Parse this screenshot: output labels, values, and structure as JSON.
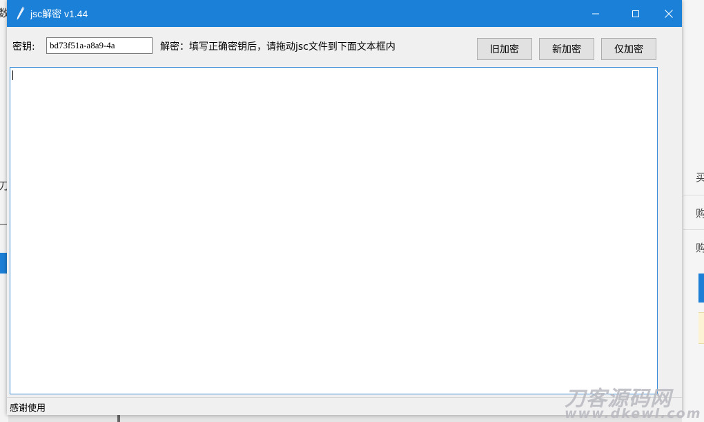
{
  "window": {
    "title": "jsc解密 v1.44"
  },
  "form": {
    "key_label": "密钥:",
    "key_value": "bd73f51a-a8a9-4a",
    "hint": "解密：填写正确密钥后，请拖动jsc文件到下面文本框内"
  },
  "buttons": {
    "old_encrypt": "旧加密",
    "new_encrypt": "新加密",
    "only_encrypt": "仅加密"
  },
  "status": {
    "text": "感谢使用"
  },
  "background": {
    "left_chars": [
      "数",
      "刀"
    ],
    "right_chars": [
      "买",
      "购",
      "购"
    ]
  },
  "watermark": {
    "cn": "刀客源码网",
    "en": "www.dkewl.com"
  },
  "colors": {
    "titlebar": "#1a80d8",
    "textarea_border": "#3d8ed8"
  },
  "icons": {
    "app": "pen-icon",
    "minimize": "minimize-icon",
    "maximize": "maximize-icon",
    "close": "close-icon"
  }
}
